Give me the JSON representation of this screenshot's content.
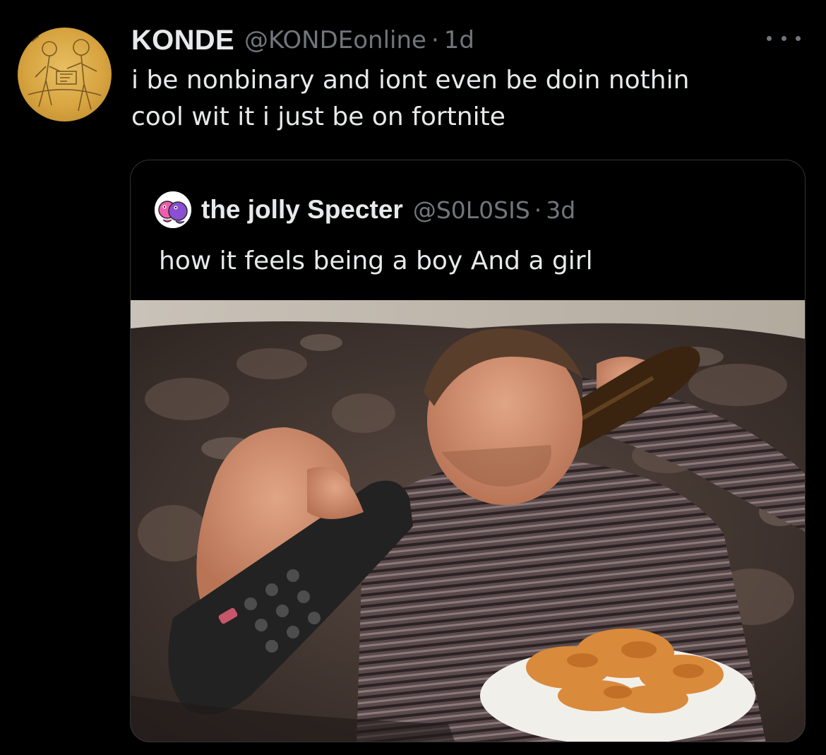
{
  "tweet": {
    "author": {
      "display_name": "KONDE",
      "handle": "@KONDEonline",
      "separator": "·",
      "time": "1d",
      "avatar_icon": "sketch-art-avatar-icon"
    },
    "text_lines": [
      "i be nonbinary and iont even be doin nothin",
      "cool wit it i just be on fortnite"
    ],
    "more_icon": "more-options-icon"
  },
  "quoted_tweet": {
    "author": {
      "display_name": "the jolly Specter",
      "handle": "@S0L0SIS",
      "separator": "·",
      "time": "3d",
      "avatar_icon": "pink-purple-creature-avatar-icon"
    },
    "text": "how it feels being a boy And a girl",
    "media": {
      "kind": "photo",
      "subject": "man on couch with remote, beer bottle and bowl of chips"
    }
  },
  "colors": {
    "background": "#000000",
    "primary_text": "#e7e9ea",
    "secondary_text": "#71767b",
    "card_border": "#2f3336"
  }
}
